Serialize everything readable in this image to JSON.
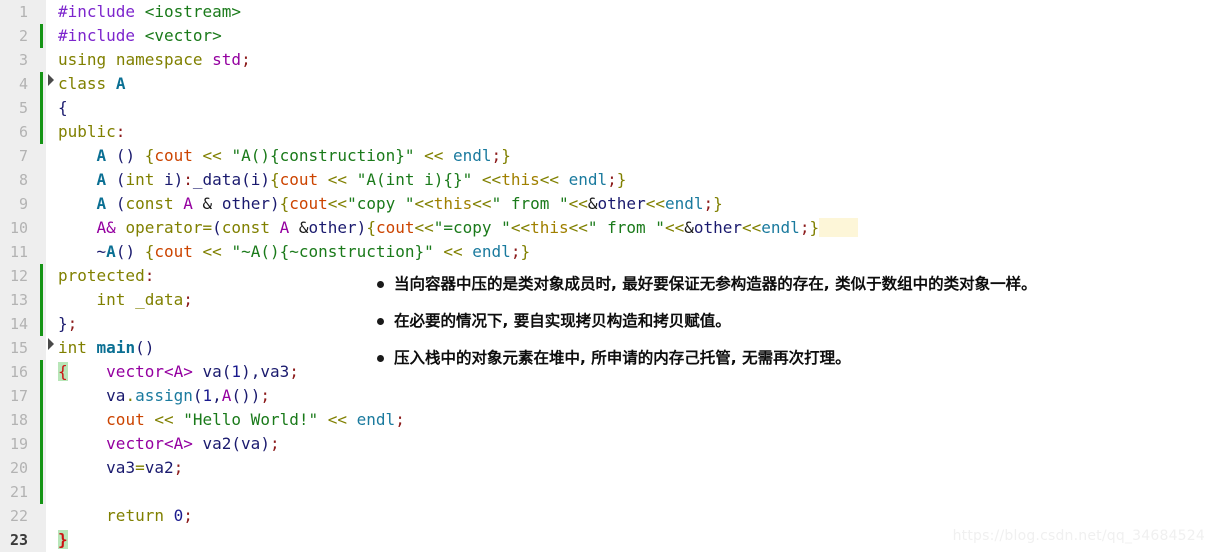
{
  "editor": {
    "language": "C++",
    "gutter_background": "#eeeeee",
    "background": "#ffffff",
    "modified_marker_color": "#159415",
    "bracket_match_color": "#b8e6b8",
    "current_line": 23,
    "total_lines": 23,
    "line_numbers": [
      "1",
      "2",
      "3",
      "4",
      "5",
      "6",
      "7",
      "8",
      "9",
      "10",
      "11",
      "12",
      "13",
      "14",
      "15",
      "16",
      "17",
      "18",
      "19",
      "20",
      "21",
      "22",
      "23"
    ],
    "fold_markers": [
      4,
      15
    ],
    "modified_ranges": [
      [
        2,
        2
      ],
      [
        4,
        6
      ],
      [
        12,
        14
      ],
      [
        16,
        21
      ]
    ],
    "lines": [
      {
        "n": "1",
        "text": "#include <iostream>"
      },
      {
        "n": "2",
        "text": "#include <vector>"
      },
      {
        "n": "3",
        "text": "using namespace std;"
      },
      {
        "n": "4",
        "text": "class A"
      },
      {
        "n": "5",
        "text": "{"
      },
      {
        "n": "6",
        "text": "public:"
      },
      {
        "n": "7",
        "text": "    A () {cout << \"A(){construction}\" << endl;}"
      },
      {
        "n": "8",
        "text": "    A (int i):_data(i){cout << \"A(int i){}\" <<this<< endl;}"
      },
      {
        "n": "9",
        "text": "    A (const A & other){cout<<\"copy \"<<this<<\" from \"<<&other<<endl;}"
      },
      {
        "n": "10",
        "text": "    A& operator=(const A &other){cout<<\"=copy \"<<this<<\" from \"<<&other<<endl;}"
      },
      {
        "n": "11",
        "text": "    ~A() {cout << \"~A(){~construction}\" << endl;}"
      },
      {
        "n": "12",
        "text": "protected:"
      },
      {
        "n": "13",
        "text": "    int _data;"
      },
      {
        "n": "14",
        "text": "};"
      },
      {
        "n": "15",
        "text": "int main()"
      },
      {
        "n": "16",
        "text": "{    vector<A> va(1),va3;"
      },
      {
        "n": "17",
        "text": "     va.assign(1,A());"
      },
      {
        "n": "18",
        "text": "     cout << \"Hello World!\" << endl;"
      },
      {
        "n": "19",
        "text": "     vector<A> va2(va);"
      },
      {
        "n": "20",
        "text": "     va3=va2;"
      },
      {
        "n": "21",
        "text": ""
      },
      {
        "n": "22",
        "text": "     return 0;"
      },
      {
        "n": "23",
        "text": "}"
      }
    ]
  },
  "annotations": {
    "bullets": [
      "当向容器中压的是类对象成员时, 最好要保证无参构造器的存在, 类似于数组中的类对象一样。",
      "在必要的情况下, 要自实现拷贝构造和拷贝赋值。",
      "压入栈中的对象元素在堆中, 所申请的内存己托管, 无需再次打理。"
    ]
  },
  "watermark": {
    "text": "https://blog.csdn.net/qq_34684524"
  }
}
